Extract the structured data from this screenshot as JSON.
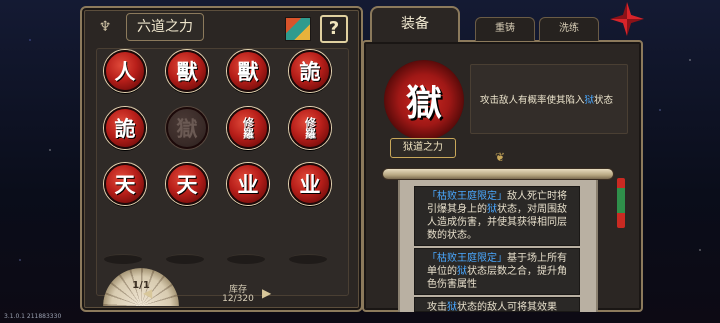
{
  "left_panel": {
    "title": "六道之力",
    "help_label": "?",
    "talents": [
      {
        "glyph": "人",
        "dim": false
      },
      {
        "glyph": "獸",
        "dim": false
      },
      {
        "glyph": "獸",
        "dim": false
      },
      {
        "glyph": "詭",
        "dim": false
      },
      {
        "glyph": "詭",
        "dim": false
      },
      {
        "glyph": "獄",
        "dim": true
      },
      {
        "glyph": "修羅",
        "dim": false
      },
      {
        "glyph": "修羅",
        "dim": false
      },
      {
        "glyph": "天",
        "dim": false
      },
      {
        "glyph": "天",
        "dim": false
      },
      {
        "glyph": "业",
        "dim": false
      },
      {
        "glyph": "业",
        "dim": false
      }
    ],
    "page_indicator": "1/1",
    "prev_arrow": "◀",
    "next_arrow": "▶",
    "storage_label": "库存",
    "storage_value": "12/320"
  },
  "right_panel": {
    "tabs": {
      "equip": "装备",
      "recast": "重铸",
      "wash": "洗练"
    },
    "selected": {
      "glyph": "獄",
      "name": "狱道之力",
      "desc_before": "攻击敌人有概率使其陷入",
      "desc_keyword": "狱",
      "desc_after": "状态"
    },
    "effects": [
      {
        "tag": "「枯败王庭限定」",
        "text_1": "敌人死亡时将引爆其身上的",
        "keyword": "狱",
        "text_2": "状态，对周围敌人造成伤害，并使其获得相同层数的状态。"
      },
      {
        "tag": "「枯败王庭限定」",
        "text_1": "基于场上所有单位的",
        "keyword": "狱",
        "text_2": "状态层数之合，提升角色伤害属性"
      },
      {
        "tag": "",
        "text_1": "攻击",
        "keyword": "狱",
        "text_2": "状态的敌人可将其效果"
      }
    ]
  },
  "version": "3.1.0.1 211883330"
}
